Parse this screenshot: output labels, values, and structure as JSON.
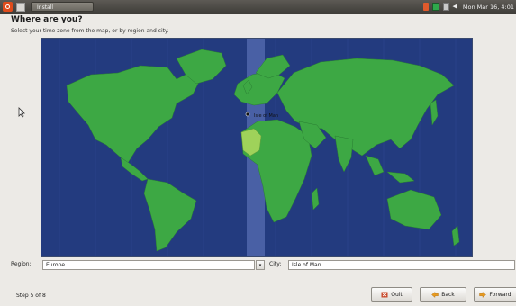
{
  "panel": {
    "task_label": "Install",
    "clock": "Mon Mar 16, 4:01"
  },
  "window": {
    "title": "Where are you?",
    "subtitle": "Select your time zone from the map, or by region and city."
  },
  "map": {
    "selected_city_label": "Isle of Man",
    "colors": {
      "ocean": "#233b7f",
      "land": "#3da844",
      "highlight": "#9fd25a",
      "band": "#6a7fc4"
    }
  },
  "form": {
    "region_label": "Region:",
    "region_value": "Europe",
    "city_label": "City:",
    "city_value": "Isle of Man"
  },
  "footer": {
    "step": "Step 5 of 8",
    "quit": "Quit",
    "back": "Back",
    "forward": "Forward"
  }
}
